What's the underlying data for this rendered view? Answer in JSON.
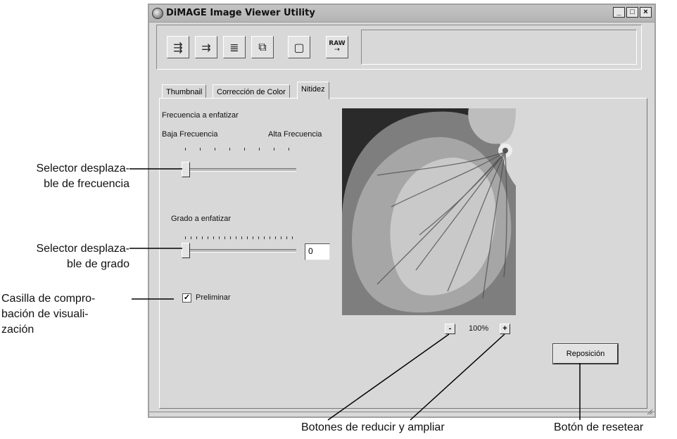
{
  "window": {
    "title": "DiMAGE Image Viewer Utility",
    "controls": {
      "minimize": "_",
      "maximize": "□",
      "close": "×"
    }
  },
  "toolbar": {
    "buttons": [
      {
        "icon": "load-camera-icon"
      },
      {
        "icon": "save-camera-icon"
      },
      {
        "icon": "batch-convert-icon"
      },
      {
        "icon": "copy-settings-icon"
      },
      {
        "icon": "camera-settings-icon"
      },
      {
        "icon": "raw-convert-icon",
        "label": "RAW"
      }
    ]
  },
  "tabs": [
    {
      "label": "Thumbnail"
    },
    {
      "label": "Corrección de Color"
    },
    {
      "label": "Nitidez",
      "active": true
    }
  ],
  "sharpness": {
    "frequency_label": "Frecuencia a enfatizar",
    "low_label": "Baja Frecuencia",
    "high_label": "Alta Frecuencia",
    "frequency_value": 0,
    "degree_label": "Grado a enfatizar",
    "degree_value": "0",
    "preview_label": "Preliminar",
    "preview_checked": true,
    "check_glyph": "✓"
  },
  "zoom": {
    "minus_label": "-",
    "plus_label": "+",
    "level": "100%"
  },
  "reset_label": "Reposición",
  "callouts": {
    "frequency": [
      "Selector desplaza-",
      "ble de frecuencia"
    ],
    "degree": [
      "Selector desplaza-",
      "ble de grado"
    ],
    "preview": [
      "Casilla de compro-",
      "bación de visuali-",
      "zación"
    ],
    "zoom": "Botones de reducir y ampliar",
    "reset": "Botón de resetear"
  }
}
